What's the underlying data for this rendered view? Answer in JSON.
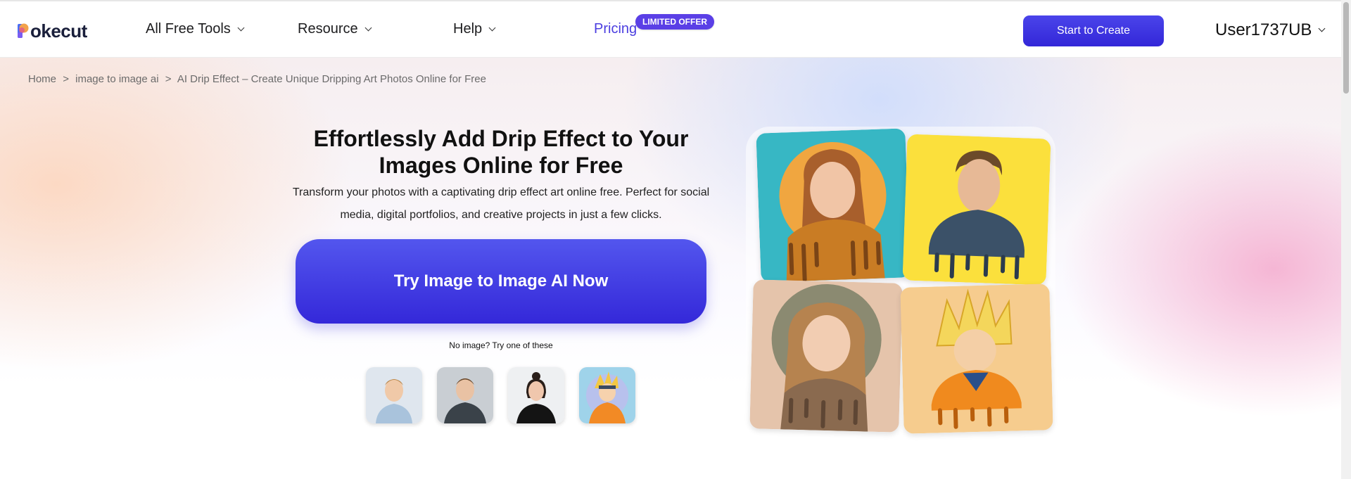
{
  "header": {
    "logo_text": "okecut",
    "nav": [
      {
        "label": "All Free Tools"
      },
      {
        "label": "Resource"
      },
      {
        "label": "Help"
      },
      {
        "label": "Pricing"
      }
    ],
    "badge": "LIMITED OFFER",
    "start_button": "Start to Create",
    "user": "User1737UB"
  },
  "breadcrumb": {
    "home": "Home",
    "sep1": ">",
    "parent": "image to image ai",
    "sep2": ">",
    "current": "AI Drip Effect – Create Unique Dripping Art Photos Online for Free"
  },
  "hero": {
    "title": "Effortlessly Add Drip Effect to Your Images Online for Free",
    "description": "Transform your photos with a captivating drip effect art online free. Perfect for social media, digital portfolios, and creative projects in just a few clicks.",
    "cta": "Try Image to Image AI Now",
    "no_image": "No image? Try one of these"
  },
  "colors": {
    "accent": "#4338e4",
    "pricing": "#4b3ee0",
    "badge": "#5a3fe6"
  },
  "icons": [
    "chevron-down-icon",
    "pokecut-logo-icon"
  ]
}
